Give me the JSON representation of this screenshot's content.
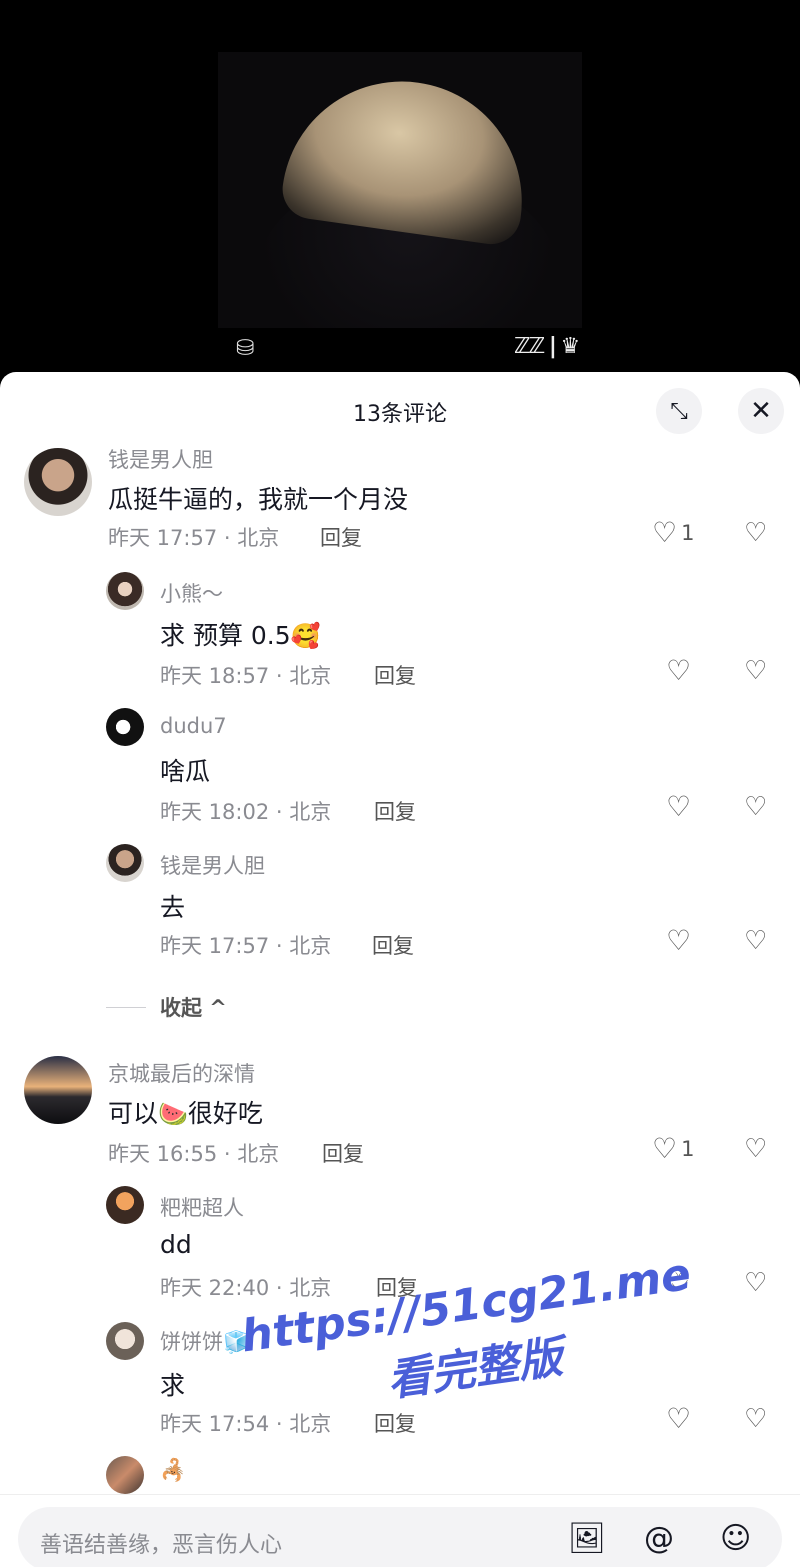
{
  "video": {
    "watermark_left": "⛁",
    "watermark_right": "ℤℤ | ♛"
  },
  "sheet": {
    "title": "13条评论",
    "expand_icon": "⤡",
    "close_icon": "✕"
  },
  "comments": [
    {
      "username": "钱是男人胆",
      "content": "瓜挺牛逼的，我就一个月没",
      "meta": "昨天 17:57 · 北京",
      "reply": "回复",
      "likes": "1",
      "avatar": "av-boy"
    },
    {
      "username": "小熊～",
      "content": "求 预算 0.5",
      "emoji": "🥰",
      "meta": "昨天 18:57 · 北京",
      "reply": "回复",
      "likes": "",
      "avatar": "av-girl"
    },
    {
      "username": "dudu7",
      "content": "啥瓜",
      "meta": "昨天 18:02 · 北京",
      "reply": "回复",
      "likes": "",
      "avatar": "av-panda"
    },
    {
      "username": "钱是男人胆",
      "content": "去",
      "meta": "昨天 17:57 · 北京",
      "reply": "回复",
      "likes": "",
      "avatar": "av-boy"
    },
    {
      "username": "京城最后的深情",
      "content_a": "可以",
      "emoji": "🍉",
      "content_b": "很好吃",
      "meta": "昨天 16:55 · 北京",
      "reply": "回复",
      "likes": "1",
      "avatar": "av-sunset"
    },
    {
      "username": "粑粑超人",
      "content": "dd",
      "meta": "昨天 22:40 · 北京",
      "reply": "回复",
      "likes": "",
      "avatar": "av-orange"
    },
    {
      "username": "饼饼饼",
      "username_emoji": "🧊",
      "content": "求",
      "meta": "昨天 17:54 · 北京",
      "reply": "回复",
      "likes": "",
      "avatar": "av-face"
    },
    {
      "username": "",
      "username_emoji": "🦂",
      "avatar": "av-room"
    }
  ],
  "collapse_label": "收起 ^",
  "overlay_watermark": {
    "line1": "https://51cg21.me",
    "line2": "看完整版"
  },
  "input": {
    "placeholder": "善语结善缘，恶言伤人心",
    "image_icon": "🖼",
    "at_icon": "@",
    "emoji_icon": "☺"
  }
}
